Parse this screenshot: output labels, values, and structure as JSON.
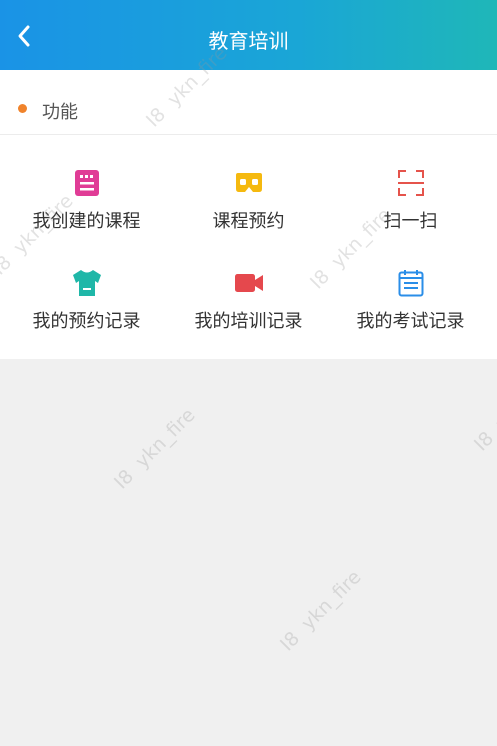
{
  "header": {
    "title": "教育培训"
  },
  "section": {
    "title": "功能",
    "dot_color": "#f0832b"
  },
  "functions": [
    {
      "label": "我创建的课程",
      "icon": "book-icon",
      "color": "#e03c96"
    },
    {
      "label": "课程预约",
      "icon": "vr-glasses-icon",
      "color": "#f5b90f"
    },
    {
      "label": "扫一扫",
      "icon": "scan-icon",
      "color": "#e5534b"
    },
    {
      "label": "我的预约记录",
      "icon": "tshirt-icon",
      "color": "#1fb7a8"
    },
    {
      "label": "我的培训记录",
      "icon": "video-camera-icon",
      "color": "#e5484d"
    },
    {
      "label": "我的考试记录",
      "icon": "calendar-list-icon",
      "color": "#2a8ee8"
    }
  ],
  "watermark": "I8  ykn_fire"
}
